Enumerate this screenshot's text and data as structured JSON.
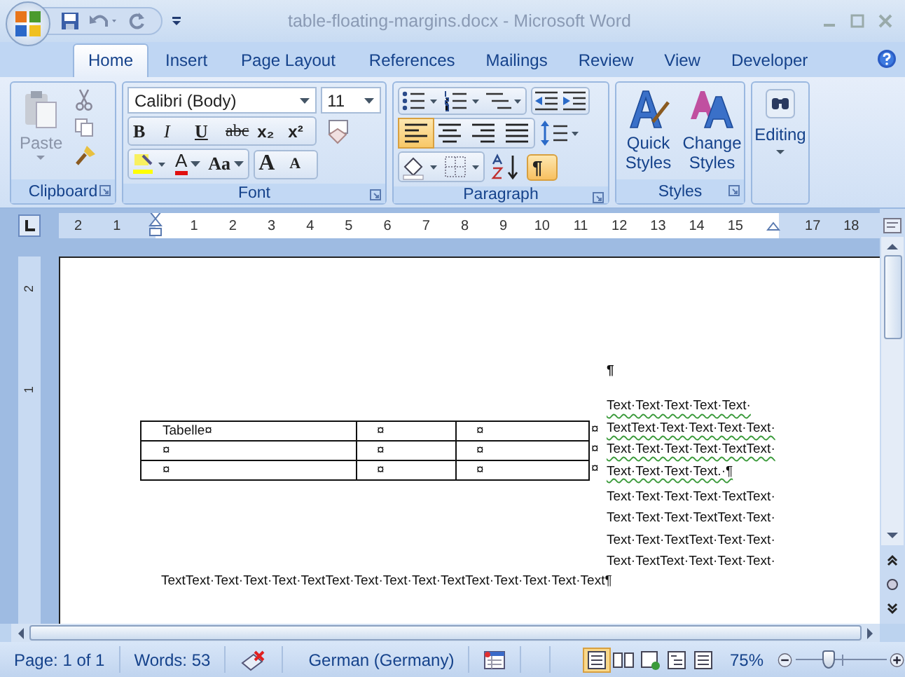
{
  "title_bar": {
    "title": "table-floating-margins.docx - Microsoft Word"
  },
  "tabs": [
    {
      "label": "Home",
      "selected": true
    },
    {
      "label": "Insert",
      "selected": false
    },
    {
      "label": "Page Layout",
      "selected": false
    },
    {
      "label": "References",
      "selected": false
    },
    {
      "label": "Mailings",
      "selected": false
    },
    {
      "label": "Review",
      "selected": false
    },
    {
      "label": "View",
      "selected": false
    },
    {
      "label": "Developer",
      "selected": false
    }
  ],
  "ribbon": {
    "clipboard": {
      "label": "Clipboard",
      "paste": "Paste"
    },
    "font": {
      "label": "Font",
      "font_name": "Calibri (Body)",
      "font_size": "11",
      "format_buttons": [
        "B",
        "I",
        "U",
        "abc",
        "x₂",
        "x²"
      ],
      "case_button": "Aa",
      "color_button": "A",
      "grow_button": "A",
      "shrink_button": "A"
    },
    "paragraph": {
      "label": "Paragraph",
      "alignment": [
        {
          "selected": true
        },
        {
          "selected": false
        },
        {
          "selected": false
        },
        {
          "selected": false
        }
      ],
      "show_marks": {
        "label": "¶",
        "selected": true
      }
    },
    "styles": {
      "label": "Styles",
      "buttons": [
        "Quick Styles",
        "Change Styles"
      ]
    },
    "editing": {
      "label": "Editing"
    }
  },
  "ruler": {
    "left_labels": [
      "2",
      "1"
    ],
    "labels": [
      "1",
      "2",
      "3",
      "4",
      "5",
      "6",
      "7",
      "8",
      "9",
      "10",
      "11",
      "12",
      "13",
      "14",
      "15"
    ],
    "right_labels": [
      "17",
      "18"
    ]
  },
  "vertical_ruler": {
    "labels": [
      "2",
      "1"
    ]
  },
  "document": {
    "pilcrow": "¶",
    "float_lines": [
      {
        "text": "Text·Text·Text·Text·Text·",
        "grammar_flag": true
      },
      {
        "text": "TextText·Text·Text·Text·Text·",
        "grammar_flag": true
      },
      {
        "text": "Text·Text·Text·Text·TextText·",
        "grammar_flag": true
      },
      {
        "text": "Text·Text·Text·Text.·¶",
        "grammar_flag": true
      }
    ],
    "side_lines": [
      {
        "text": "Text·Text·Text·Text·TextText·",
        "grammar_flag": false
      },
      {
        "text": "Text·Text·Text·TextText·Text·",
        "grammar_flag": false
      },
      {
        "text": "Text·Text·TextText·Text·Text·",
        "grammar_flag": false
      },
      {
        "text": "Text·TextText·Text·Text·Text·",
        "grammar_flag": false
      }
    ],
    "table": {
      "rows": [
        [
          "Tabelle¤",
          "¤",
          "¤"
        ],
        [
          "¤",
          "¤",
          "¤"
        ],
        [
          "¤",
          "¤",
          "¤"
        ]
      ],
      "row_end_marks": [
        "¤",
        "¤",
        "¤"
      ]
    },
    "body_line": "TextText·Text·Text·Text·TextText·Text·Text·Text·TextText·Text·Text·Text·Text¶"
  },
  "status_bar": {
    "page": "Page: 1 of 1",
    "words": "Words: 53",
    "language": "German (Germany)",
    "views": [
      {
        "selected": true
      },
      {
        "selected": false
      },
      {
        "selected": false
      },
      {
        "selected": false
      },
      {
        "selected": false
      }
    ],
    "zoom": "75%",
    "zoom_slider": {
      "level": 0.37
    }
  }
}
